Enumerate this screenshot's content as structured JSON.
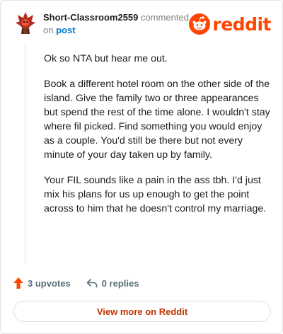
{
  "comment": {
    "username": "Short-Classroom2559",
    "action": " commented",
    "on_text": "on ",
    "post_link": "post",
    "body": [
      "Ok so NTA but hear me out.",
      "Book a different hotel room on the other side of the island. Give the family two or three appearances but spend the rest of the time alone. I wouldn't stay where fil picked. Find something you would enjoy as a couple. You'd still be there but not every minute of your day taken up by family.",
      "Your FIL sounds like a pain in the ass tbh. I'd just mix his plans for us up enough to get the point across to him that he doesn't control my marriage."
    ]
  },
  "brand": {
    "wordmark": "reddit",
    "color": "#ff4500"
  },
  "footer": {
    "upvotes": "3 upvotes",
    "replies": "0 replies"
  },
  "cta": {
    "label": "View more on Reddit"
  },
  "icons": {
    "upvote": "upvote-arrow-icon",
    "reply": "reply-arrow-icon",
    "logo": "reddit-snoo-icon",
    "avatar": "user-avatar"
  }
}
